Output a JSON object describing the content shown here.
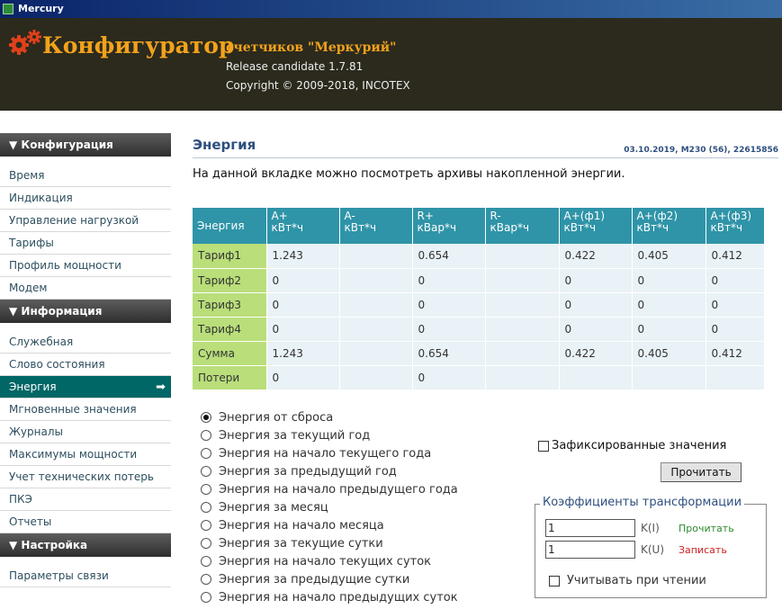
{
  "window": {
    "title": "Mercury"
  },
  "header": {
    "title": "Конфигуратор",
    "subtitle": "счетчиков \"Меркурий\"",
    "release": "Release candidate 1.7.81",
    "copyright": "Copyright © 2009-2018, INCOTEX"
  },
  "sidebar": {
    "sections": [
      {
        "title": "▼ Конфигурация",
        "items": [
          "Время",
          "Индикация",
          "Управление нагрузкой",
          "Тарифы",
          "Профиль мощности",
          "Модем"
        ]
      },
      {
        "title": "▼ Информация",
        "items": [
          "Служебная",
          "Слово состояния",
          "Энергия",
          "Мгновенные значения",
          "Журналы",
          "Максимумы мощности",
          "Учет технических потерь",
          "ПКЭ",
          "Отчеты"
        ]
      },
      {
        "title": "▼ Настройка",
        "items": [
          "Параметры связи"
        ]
      }
    ],
    "active_item": "Энергия",
    "active_arrow": "➡"
  },
  "content": {
    "page_title": "Энергия",
    "device_info": "03.10.2019, M230 (56), 22615856",
    "description": "На данной вкладке можно посмотреть архивы накопленной энергии."
  },
  "table": {
    "row_header": "Энергия",
    "columns": [
      [
        "A+",
        "кВт*ч"
      ],
      [
        "A-",
        "кВт*ч"
      ],
      [
        "R+",
        "кВар*ч"
      ],
      [
        "R-",
        "кВар*ч"
      ],
      [
        "A+(ф1)",
        "кВт*ч"
      ],
      [
        "A+(ф2)",
        "кВт*ч"
      ],
      [
        "A+(ф3)",
        "кВт*ч"
      ]
    ],
    "rows": [
      {
        "label": "Тариф1",
        "values": [
          "1.243",
          "",
          "0.654",
          "",
          "0.422",
          "0.405",
          "0.412"
        ]
      },
      {
        "label": "Тариф2",
        "values": [
          "0",
          "",
          "0",
          "",
          "0",
          "0",
          "0"
        ]
      },
      {
        "label": "Тариф3",
        "values": [
          "0",
          "",
          "0",
          "",
          "0",
          "0",
          "0"
        ]
      },
      {
        "label": "Тариф4",
        "values": [
          "0",
          "",
          "0",
          "",
          "0",
          "0",
          "0"
        ]
      },
      {
        "label": "Сумма",
        "values": [
          "1.243",
          "",
          "0.654",
          "",
          "0.422",
          "0.405",
          "0.412"
        ]
      },
      {
        "label": "Потери",
        "values": [
          "0",
          "",
          "0",
          "",
          "",
          "",
          ""
        ]
      }
    ]
  },
  "energy_options": {
    "items": [
      "Энергия от сброса",
      "Энергия за текущий год",
      "Энергия на начало текущего года",
      "Энергия за предыдущий год",
      "Энергия на начало предыдущего года",
      "Энергия за месяц",
      "Энергия на начало месяца",
      "Энергия за текущие сутки",
      "Энергия на начало текущих суток",
      "Энергия за предыдущие сутки",
      "Энергия на начало предыдущих суток"
    ],
    "selected_index": 0
  },
  "controls": {
    "fixed_values_label": "Зафиксированные значения",
    "read_button": "Прочитать"
  },
  "coefficients": {
    "legend": "Коэффициенты трансформации",
    "k_i": {
      "value": "1",
      "label": "K(I)",
      "action": "Прочитать"
    },
    "k_u": {
      "value": "1",
      "label": "K(U)",
      "action": "Записать"
    },
    "use_on_read_label": "Учитывать при чтении"
  }
}
